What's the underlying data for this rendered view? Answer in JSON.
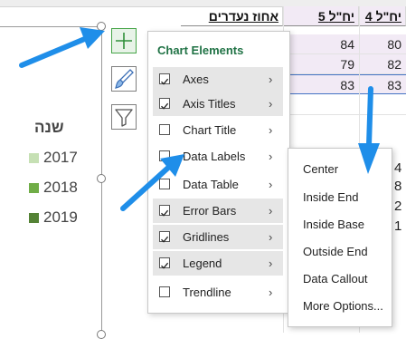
{
  "sheet": {
    "headers": [
      "4 יח\"ל",
      "5 יח\"ל",
      "אחוז נעדרים"
    ],
    "rows": [
      [
        "80",
        "84"
      ],
      [
        "82",
        "79"
      ],
      [
        "83",
        "83"
      ]
    ],
    "side_values": [
      "4",
      "8",
      "2",
      "1"
    ]
  },
  "legend": {
    "title": "שנה",
    "items": [
      {
        "label": "2017",
        "color": "#c6e0b4"
      },
      {
        "label": "2018",
        "color": "#70ad47"
      },
      {
        "label": "2019",
        "color": "#548235"
      }
    ]
  },
  "tools": {
    "elements_icon": "plus-icon",
    "styles_icon": "paintbrush-icon",
    "filters_icon": "funnel-icon"
  },
  "chart_elements": {
    "title": "Chart Elements",
    "items": [
      {
        "label": "Axes",
        "checked": true
      },
      {
        "label": "Axis Titles",
        "checked": true
      },
      {
        "label": "Chart Title",
        "checked": false
      },
      {
        "label": "Data Labels",
        "checked": false
      },
      {
        "label": "Data Table",
        "checked": false
      },
      {
        "label": "Error Bars",
        "checked": true
      },
      {
        "label": "Gridlines",
        "checked": true
      },
      {
        "label": "Legend",
        "checked": true
      },
      {
        "label": "Trendline",
        "checked": false
      }
    ],
    "chevron": "›"
  },
  "data_labels_submenu": {
    "items": [
      "Center",
      "Inside End",
      "Inside Base",
      "Outside End",
      "Data Callout",
      "More Options..."
    ]
  },
  "colors": {
    "accent_green": "#217346",
    "arrow_blue": "#1f8ee9"
  }
}
